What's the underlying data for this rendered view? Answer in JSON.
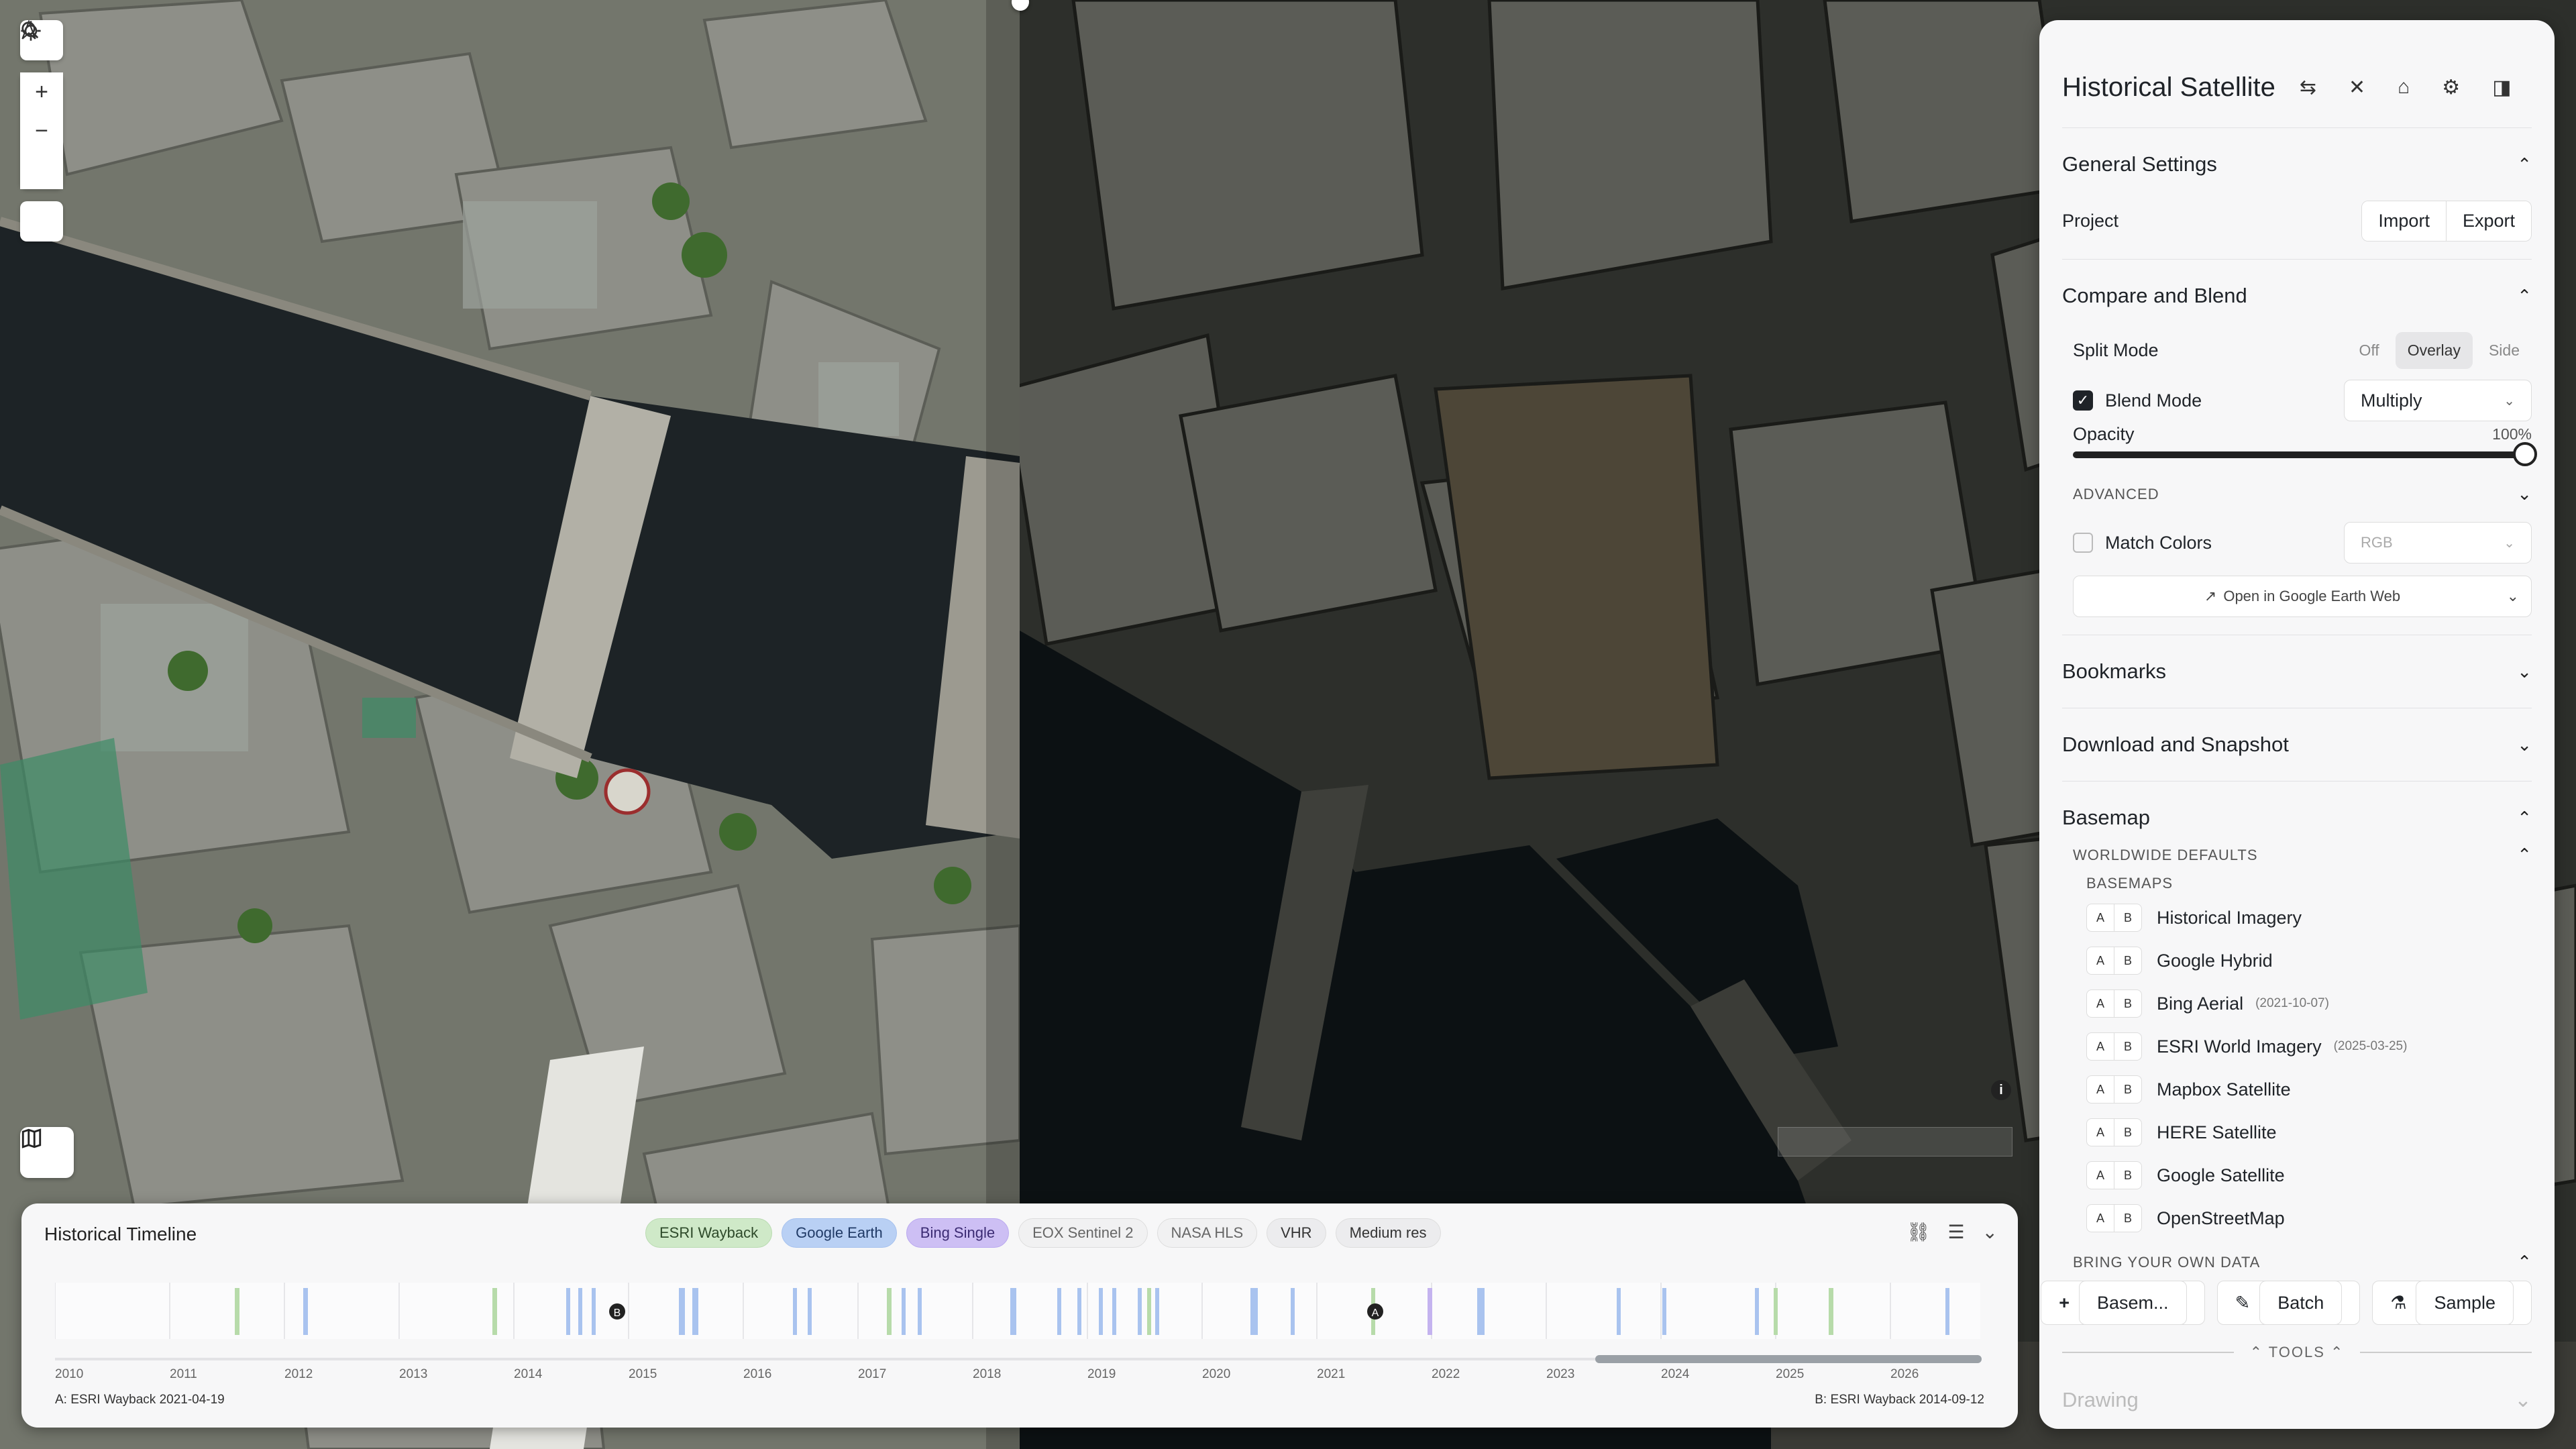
{
  "map": {
    "tools": {
      "search_icon": "search-icon",
      "zoom_in": "+",
      "zoom_out": "−",
      "north": "A",
      "locate_icon": "locate-icon",
      "layers_icon": "map-icon"
    },
    "colors": {
      "split_left": "#6f7268",
      "split_right": "#2b2d29",
      "river": "#1d2326",
      "river_right": "#0b0f11"
    }
  },
  "timeline": {
    "title": "Historical Timeline",
    "chips": [
      {
        "label": "ESRI Wayback",
        "tone": "green"
      },
      {
        "label": "Google Earth",
        "tone": "blue"
      },
      {
        "label": "Bing Single",
        "tone": "purple"
      },
      {
        "label": "EOX Sentinel 2",
        "tone": "plain"
      },
      {
        "label": "NASA HLS",
        "tone": "plain"
      },
      {
        "label": "VHR",
        "tone": "gray"
      },
      {
        "label": "Medium res",
        "tone": "gray"
      }
    ],
    "years": [
      "2010",
      "2011",
      "2012",
      "2013",
      "2014",
      "2015",
      "2016",
      "2017",
      "2018",
      "2019",
      "2020",
      "2021",
      "2022",
      "2023",
      "2024",
      "2025",
      "2026"
    ],
    "marker_b": "B",
    "marker_a": "A",
    "footer_a": "A: ESRI Wayback 2021-04-19",
    "footer_b": "B: ESRI Wayback 2014-09-12"
  },
  "panel": {
    "title": "Historical Satellite",
    "general": {
      "title": "General Settings",
      "project_label": "Project",
      "import": "Import",
      "export": "Export"
    },
    "compare": {
      "title": "Compare and Blend",
      "split_label": "Split Mode",
      "split_options": [
        "Off",
        "Overlay",
        "Side"
      ],
      "split_active": "Overlay",
      "blend_label": "Blend Mode",
      "blend_value": "Multiply",
      "opacity_label": "Opacity",
      "opacity_value": "100%",
      "opacity_fraction": 1.0,
      "advanced": "ADVANCED",
      "match_label": "Match Colors",
      "match_value": "RGB",
      "ge_label": "Open in Google Earth Web"
    },
    "bookmarks": "Bookmarks",
    "download": "Download and Snapshot",
    "basemap": {
      "title": "Basemap",
      "worldwide": "WORLDWIDE DEFAULTS",
      "basemaps": "BASEMAPS",
      "items": [
        {
          "name": "Historical Imagery",
          "date": ""
        },
        {
          "name": "Google Hybrid",
          "date": ""
        },
        {
          "name": "Bing Aerial",
          "date": "(2021-10-07)"
        },
        {
          "name": "ESRI World Imagery",
          "date": "(2025-03-25)"
        },
        {
          "name": "Mapbox Satellite",
          "date": ""
        },
        {
          "name": "HERE Satellite",
          "date": ""
        },
        {
          "name": "Google Satellite",
          "date": ""
        },
        {
          "name": "OpenStreetMap",
          "date": ""
        }
      ],
      "byo": "BRING YOUR OWN DATA",
      "byo_buttons": [
        "Basem...",
        "Batch",
        "Sample"
      ]
    },
    "tools_label": "TOOLS",
    "drawing": "Drawing"
  }
}
